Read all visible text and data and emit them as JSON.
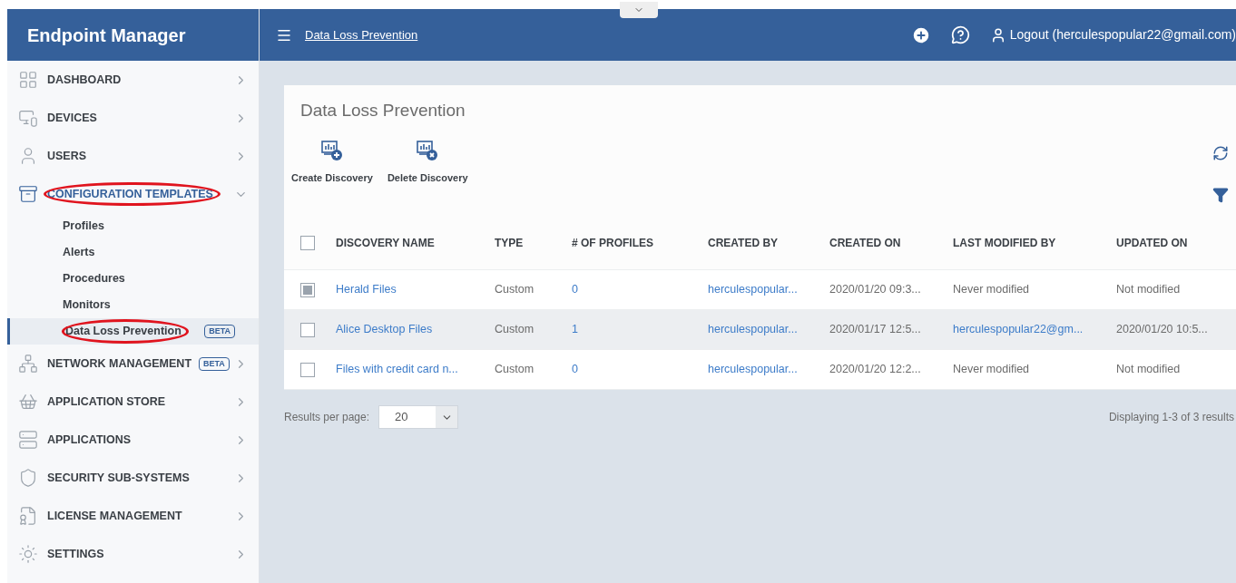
{
  "header": {
    "app_title": "Endpoint Manager",
    "breadcrumb": "Data Loss Prevention",
    "logout": "Logout (herculespopular22@gmail.com)"
  },
  "sidebar": {
    "items": [
      {
        "label": "DASHBOARD",
        "expanded": false,
        "circled": false
      },
      {
        "label": "DEVICES",
        "expanded": false,
        "circled": false
      },
      {
        "label": "USERS",
        "expanded": false,
        "circled": false
      },
      {
        "label": "CONFIGURATION TEMPLATES",
        "expanded": true,
        "circled": true,
        "children": [
          {
            "label": "Profiles",
            "selected": false,
            "circled": false
          },
          {
            "label": "Alerts",
            "selected": false,
            "circled": false
          },
          {
            "label": "Procedures",
            "selected": false,
            "circled": false
          },
          {
            "label": "Monitors",
            "selected": false,
            "circled": false
          },
          {
            "label": "Data Loss Prevention",
            "selected": true,
            "circled": true,
            "badge": "BETA"
          }
        ]
      },
      {
        "label": "NETWORK MANAGEMENT",
        "expanded": false,
        "circled": false,
        "badge": "BETA"
      },
      {
        "label": "APPLICATION STORE",
        "expanded": false,
        "circled": false
      },
      {
        "label": "APPLICATIONS",
        "expanded": false,
        "circled": false
      },
      {
        "label": "SECURITY SUB-SYSTEMS",
        "expanded": false,
        "circled": false
      },
      {
        "label": "LICENSE MANAGEMENT",
        "expanded": false,
        "circled": false
      },
      {
        "label": "SETTINGS",
        "expanded": false,
        "circled": false
      }
    ]
  },
  "page": {
    "title": "Data Loss Prevention",
    "actions": [
      {
        "label": "Create Discovery",
        "kind": "create"
      },
      {
        "label": "Delete Discovery",
        "kind": "delete"
      }
    ]
  },
  "table": {
    "columns": [
      "DISCOVERY NAME",
      "TYPE",
      "# OF PROFILES",
      "CREATED BY",
      "CREATED ON",
      "LAST MODIFIED BY",
      "UPDATED ON"
    ],
    "header_checked": false,
    "rows": [
      {
        "checked": true,
        "highlighted": false,
        "cells": [
          {
            "text": "Herald Files",
            "link": true
          },
          {
            "text": "Custom",
            "link": false
          },
          {
            "text": "0",
            "link": true
          },
          {
            "text": "herculespopular...",
            "link": true
          },
          {
            "text": "2020/01/20 09:3...",
            "link": false
          },
          {
            "text": "Never modified",
            "link": false
          },
          {
            "text": "Not modified",
            "link": false
          }
        ]
      },
      {
        "checked": false,
        "highlighted": true,
        "cells": [
          {
            "text": "Alice Desktop Files",
            "link": true
          },
          {
            "text": "Custom",
            "link": false
          },
          {
            "text": "1",
            "link": true
          },
          {
            "text": "herculespopular...",
            "link": true
          },
          {
            "text": "2020/01/17 12:5...",
            "link": false
          },
          {
            "text": "herculespopular22@gm...",
            "link": true
          },
          {
            "text": "2020/01/20 10:5...",
            "link": false
          }
        ]
      },
      {
        "checked": false,
        "highlighted": false,
        "cells": [
          {
            "text": "Files with credit card n...",
            "link": true
          },
          {
            "text": "Custom",
            "link": false
          },
          {
            "text": "0",
            "link": true
          },
          {
            "text": "herculespopular...",
            "link": true
          },
          {
            "text": "2020/01/20 12:2...",
            "link": false
          },
          {
            "text": "Never modified",
            "link": false
          },
          {
            "text": "Not modified",
            "link": false
          }
        ]
      }
    ]
  },
  "footer": {
    "results_label": "Results per page:",
    "per_page": "20",
    "summary": "Displaying 1-3 of 3 results"
  }
}
